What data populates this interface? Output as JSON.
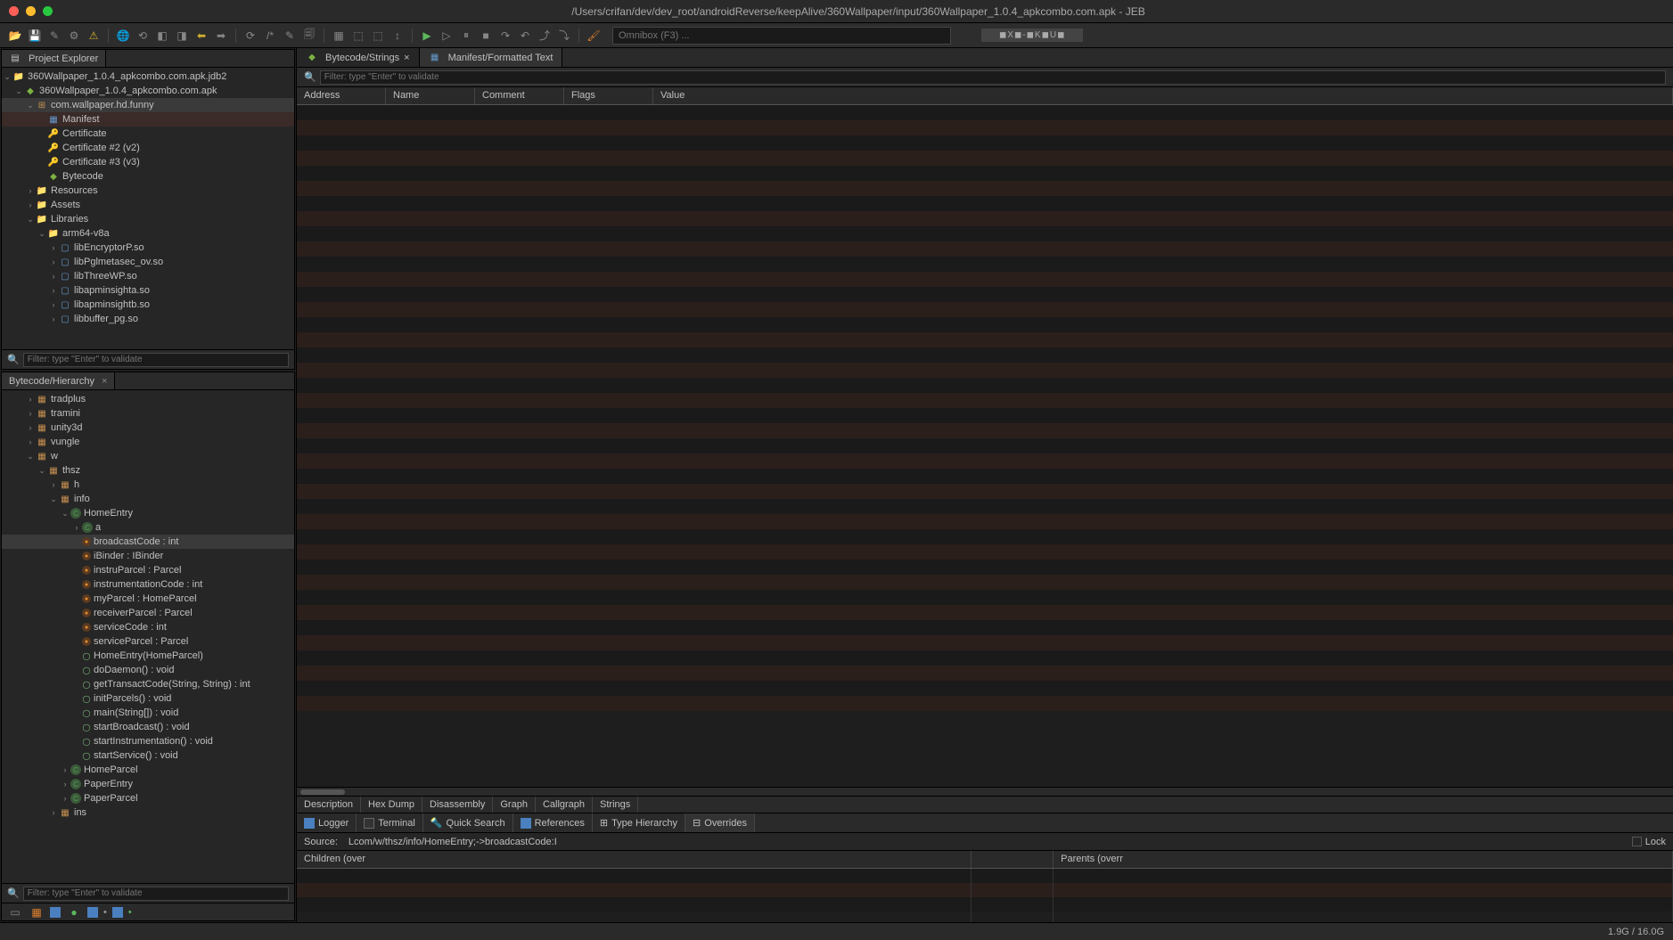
{
  "titlebar": {
    "title": "/Users/crifan/dev/dev_root/androidReverse/keepAlive/360Wallpaper/input/360Wallpaper_1.0.4_apkcombo.com.apk - JEB"
  },
  "toolbar": {
    "omnibox_placeholder": "Omnibox (F3) ...",
    "license_text": "◼X◼-◼K◼U◼"
  },
  "project_explorer": {
    "tab_label": "Project Explorer",
    "filter_placeholder": "Filter: type \"Enter\" to validate",
    "tree": {
      "root": "360Wallpaper_1.0.4_apkcombo.com.apk.jdb2",
      "apk": "360Wallpaper_1.0.4_apkcombo.com.apk",
      "package": "com.wallpaper.hd.funny",
      "items": {
        "manifest": "Manifest",
        "cert": "Certificate",
        "cert2": "Certificate #2 (v2)",
        "cert3": "Certificate #3 (v3)",
        "bytecode": "Bytecode",
        "resources": "Resources",
        "assets": "Assets",
        "libraries": "Libraries",
        "arm64": "arm64-v8a",
        "lib1": "libEncryptorP.so",
        "lib2": "libPglmetasec_ov.so",
        "lib3": "libThreeWP.so",
        "lib4": "libapminsighta.so",
        "lib5": "libapminsightb.so",
        "lib6": "libbuffer_pg.so"
      }
    }
  },
  "hierarchy": {
    "tab_label": "Bytecode/Hierarchy",
    "filter_placeholder": "Filter: type \"Enter\" to validate",
    "items": {
      "tradplus": "tradplus",
      "tramini": "tramini",
      "unity3d": "unity3d",
      "vungle": "vungle",
      "w": "w",
      "thsz": "thsz",
      "h": "h",
      "info": "info",
      "homeentry": "HomeEntry",
      "a": "a",
      "broadcastCode": "broadcastCode : int",
      "iBinder": "iBinder : IBinder",
      "instruParcel": "instruParcel : Parcel",
      "instrumentationCode": "instrumentationCode : int",
      "myParcel": "myParcel : HomeParcel",
      "receiverParcel": "receiverParcel : Parcel",
      "serviceCode": "serviceCode : int",
      "serviceParcel": "serviceParcel : Parcel",
      "ctor": "HomeEntry(HomeParcel)",
      "doDaemon": "doDaemon() : void",
      "getTransactCode": "getTransactCode(String, String) : int",
      "initParcels": "initParcels() : void",
      "main": "main(String[]) : void",
      "startBroadcast": "startBroadcast() : void",
      "startInstrumentation": "startInstrumentation() : void",
      "startService": "startService() : void",
      "homeParcel": "HomeParcel",
      "paperEntry": "PaperEntry",
      "paperParcel": "PaperParcel",
      "ins": "ins"
    }
  },
  "editor": {
    "tabs": {
      "bytecode_strings": "Bytecode/Strings",
      "manifest_text": "Manifest/Formatted Text"
    },
    "filter_placeholder": "Filter: type \"Enter\" to validate",
    "columns": {
      "address": "Address",
      "name": "Name",
      "comment": "Comment",
      "flags": "Flags",
      "value": "Value"
    },
    "lower_tabs": {
      "desc": "Description",
      "hex": "Hex Dump",
      "disasm": "Disassembly",
      "graph": "Graph",
      "callgraph": "Callgraph",
      "strings": "Strings"
    }
  },
  "tools": {
    "tabs": {
      "logger": "Logger",
      "terminal": "Terminal",
      "quicksearch": "Quick Search",
      "references": "References",
      "typehierarchy": "Type Hierarchy",
      "overrides": "Overrides"
    },
    "source_label": "Source:",
    "source_value": "Lcom/w/thsz/info/HomeEntry;->broadcastCode:I",
    "lock_label": "Lock",
    "children_label": "Children (over",
    "parents_label": "Parents (overr"
  },
  "statusbar": {
    "memory": "1.9G / 16.0G"
  }
}
